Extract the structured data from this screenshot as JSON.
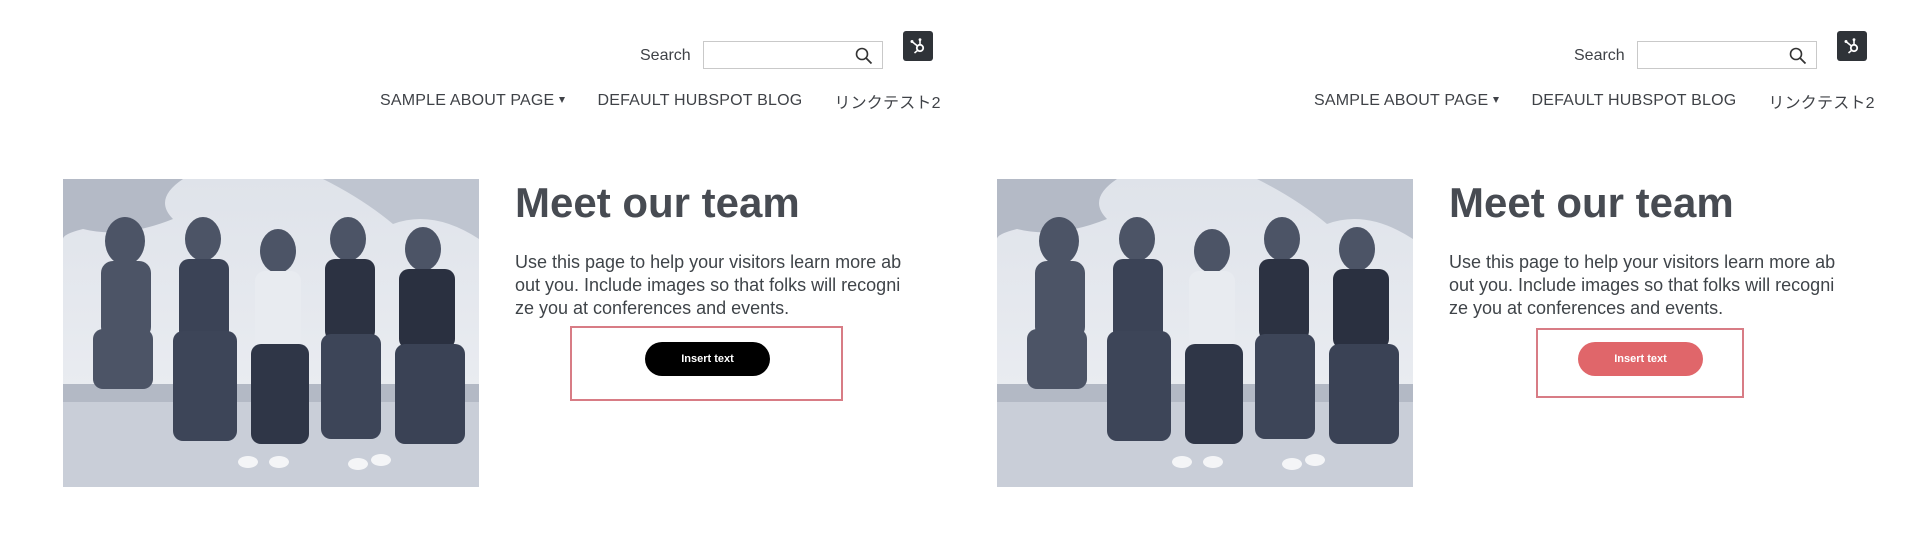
{
  "header": {
    "search_label": "Search",
    "search_value": "",
    "search_icon": "search-icon",
    "badge_icon": "hubspot-sprocket-icon"
  },
  "nav": {
    "items": [
      {
        "label": "SAMPLE ABOUT PAGE",
        "has_dropdown": true
      },
      {
        "label": "DEFAULT HUBSPOT BLOG",
        "has_dropdown": false
      },
      {
        "label": "リンクテスト2",
        "has_dropdown": false
      }
    ]
  },
  "content": {
    "heading": "Meet our team",
    "paragraph": "Use this page to help your visitors learn more about you. Include images so that folks will recognize you at conferences and events.",
    "image_alt": "team-photo"
  },
  "panels": [
    {
      "button_label": "Insert text",
      "button_color": "#000000"
    },
    {
      "button_label": "Insert text",
      "button_color": "#e0666a"
    }
  ],
  "colors": {
    "highlight_frame": "#d87c85",
    "badge_bg": "#2f3338",
    "text": "#444a52"
  }
}
